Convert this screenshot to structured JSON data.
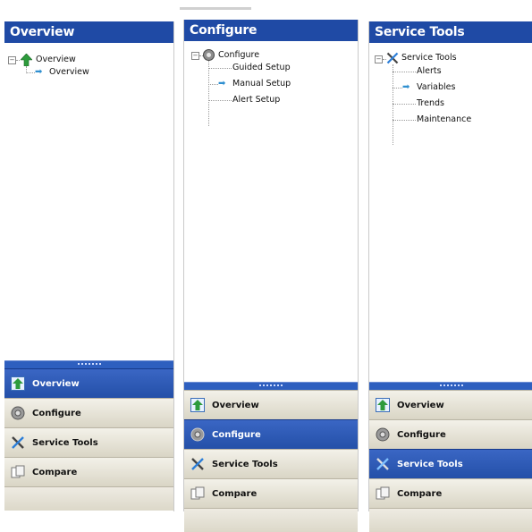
{
  "panels": [
    {
      "title": "Overview",
      "tree": {
        "root": "Overview",
        "children": [
          "Overview"
        ],
        "selected": 0
      },
      "nav": [
        {
          "label": "Overview",
          "icon": "overview-icon",
          "active": true
        },
        {
          "label": "Configure",
          "icon": "configure-icon",
          "active": false
        },
        {
          "label": "Service Tools",
          "icon": "service-tools-icon",
          "active": false
        },
        {
          "label": "Compare",
          "icon": "compare-icon",
          "active": false
        }
      ]
    },
    {
      "title": "Configure",
      "tree": {
        "root": "Configure",
        "children": [
          "Guided Setup",
          "Manual Setup",
          "Alert Setup"
        ],
        "selected": 1
      },
      "nav": [
        {
          "label": "Overview",
          "icon": "overview-icon",
          "active": false
        },
        {
          "label": "Configure",
          "icon": "configure-icon",
          "active": true
        },
        {
          "label": "Service Tools",
          "icon": "service-tools-icon",
          "active": false
        },
        {
          "label": "Compare",
          "icon": "compare-icon",
          "active": false
        }
      ]
    },
    {
      "title": "Service Tools",
      "tree": {
        "root": "Service Tools",
        "children": [
          "Alerts",
          "Variables",
          "Trends",
          "Maintenance"
        ],
        "selected": 1
      },
      "nav": [
        {
          "label": "Overview",
          "icon": "overview-icon",
          "active": false
        },
        {
          "label": "Configure",
          "icon": "configure-icon",
          "active": false
        },
        {
          "label": "Service Tools",
          "icon": "service-tools-icon",
          "active": true
        },
        {
          "label": "Compare",
          "icon": "compare-icon",
          "active": false
        }
      ]
    }
  ],
  "colors": {
    "title_bar": "#1f4aa5",
    "active_nav": "#2450a8",
    "selection_arrow": "#2f8fd0"
  }
}
